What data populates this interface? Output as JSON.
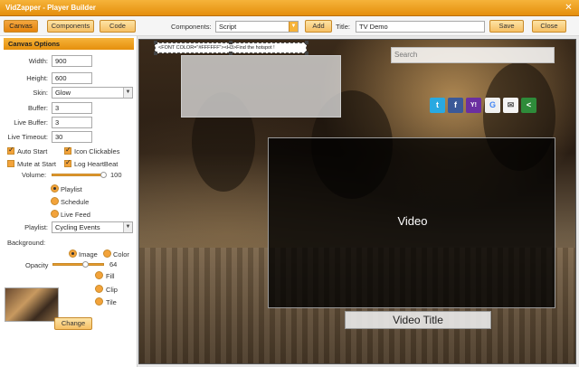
{
  "window": {
    "title": "VidZapper - Player Builder",
    "close_glyph": "✕"
  },
  "toolbar": {
    "tabs": [
      {
        "label": "Canvas",
        "active": true
      },
      {
        "label": "Components",
        "active": false
      },
      {
        "label": "Code",
        "active": false
      }
    ],
    "components_label": "Components:",
    "components_value": "Script",
    "add_label": "Add",
    "title_label": "Title:",
    "title_value": "TV Demo",
    "save_label": "Save",
    "close_label": "Close"
  },
  "canvas_options": {
    "header": "Canvas Options",
    "width_label": "Width:",
    "width_value": "900",
    "height_label": "Height:",
    "height_value": "600",
    "skin_label": "Skin:",
    "skin_value": "Glow",
    "buffer_label": "Buffer:",
    "buffer_value": "3",
    "live_buffer_label": "Live Buffer:",
    "live_buffer_value": "3",
    "live_timeout_label": "Live Timeout:",
    "live_timeout_value": "30",
    "auto_start_label": "Auto Start",
    "auto_start": true,
    "icon_clickables_label": "Icon Clickables",
    "icon_clickables": true,
    "mute_at_start_label": "Mute at Start",
    "mute_at_start": false,
    "log_heartbeat_label": "Log HeartBeat",
    "log_heartbeat": true,
    "volume_label": "Volume:",
    "volume_value": "100",
    "mode_options": [
      {
        "label": "Playlist",
        "checked": true
      },
      {
        "label": "Schedule",
        "checked": false
      },
      {
        "label": "Live Feed",
        "checked": false
      }
    ],
    "playlist_label": "Playlist:",
    "playlist_value": "Cycling Events",
    "background_label": "Background:",
    "background_image_label": "Image",
    "background_color_label": "Color",
    "opacity_label": "Opacity",
    "opacity_value": "64",
    "fit_options": [
      {
        "label": "Fill",
        "checked": false
      },
      {
        "label": "Clip",
        "checked": false
      },
      {
        "label": "Tile",
        "checked": false
      }
    ],
    "change_label": "Change"
  },
  "stage": {
    "hotspot_text": "<FONT COLOR=\"#FFFFFF\"><H3>Find the hotspot !",
    "search_placeholder": "Search",
    "social_icons": [
      {
        "name": "twitter-icon",
        "glyph": "t",
        "color": "#29a9e1"
      },
      {
        "name": "facebook-icon",
        "glyph": "f",
        "color": "#3b5998"
      },
      {
        "name": "yahoo-icon",
        "glyph": "Y!",
        "color": "#6b2fa0"
      },
      {
        "name": "google-icon",
        "glyph": "G",
        "color": "#f0f0f0"
      },
      {
        "name": "email-icon",
        "glyph": "✉",
        "color": "#f4f4f4"
      },
      {
        "name": "share-icon",
        "glyph": "<",
        "color": "#2e8b3a"
      }
    ],
    "video_label": "Video",
    "video_title": "Video Title"
  }
}
